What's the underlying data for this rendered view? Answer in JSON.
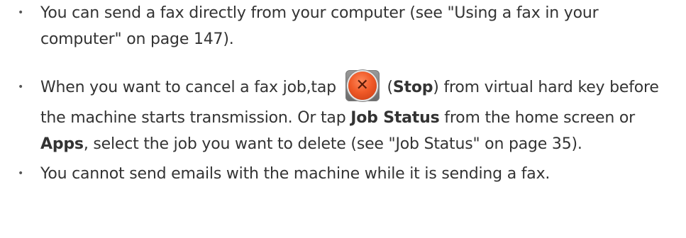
{
  "bullets": [
    {
      "text": "You can send a fax directly from your computer (see \"Using a fax in your computer\" on page 147)."
    },
    {
      "before_icon": "When you want to cancel a fax job,tap",
      "icon": "stop-icon",
      "paren_open": " (",
      "stop_label": "Stop",
      "after_stop": ") from virtual hard key before the machine starts transmission. Or tap ",
      "job_status_label": "Job Status",
      "middle": "  from the home screen or ",
      "apps_label": "Apps",
      "end": ", select the job you want to delete (see \"Job Status\" on page 35)."
    },
    {
      "text": "You cannot send emails with the machine while it is sending a fax."
    }
  ],
  "colors": {
    "text": "#333333",
    "stop_button": "#f05a28"
  }
}
